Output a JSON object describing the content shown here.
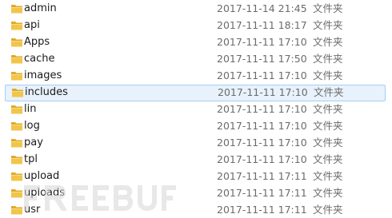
{
  "files": [
    {
      "name": "admin",
      "date": "2017-11-14 21:45",
      "type": "文件夹",
      "icon": "folder-icon"
    },
    {
      "name": "api",
      "date": "2017-11-11 18:17",
      "type": "文件夹",
      "icon": "folder-icon"
    },
    {
      "name": "Apps",
      "date": "2017-11-11 17:10",
      "type": "文件夹",
      "icon": "folder-icon"
    },
    {
      "name": "cache",
      "date": "2017-11-11 17:50",
      "type": "文件夹",
      "icon": "folder-icon"
    },
    {
      "name": "images",
      "date": "2017-11-11 17:10",
      "type": "文件夹",
      "icon": "folder-icon"
    },
    {
      "name": "includes",
      "date": "2017-11-11 17:10",
      "type": "文件夹",
      "icon": "folder-icon",
      "selected": true
    },
    {
      "name": "lin",
      "date": "2017-11-11 17:10",
      "type": "文件夹",
      "icon": "folder-icon"
    },
    {
      "name": "log",
      "date": "2017-11-11 17:10",
      "type": "文件夹",
      "icon": "folder-icon"
    },
    {
      "name": "pay",
      "date": "2017-11-11 17:10",
      "type": "文件夹",
      "icon": "folder-icon"
    },
    {
      "name": "tpl",
      "date": "2017-11-11 17:10",
      "type": "文件夹",
      "icon": "folder-icon"
    },
    {
      "name": "upload",
      "date": "2017-11-11 17:11",
      "type": "文件夹",
      "icon": "folder-icon"
    },
    {
      "name": "uploads",
      "date": "2017-11-11 17:11",
      "type": "文件夹",
      "icon": "folder-icon"
    },
    {
      "name": "usr",
      "date": "2017-11-11 17:11",
      "type": "文件夹",
      "icon": "folder-icon"
    }
  ],
  "watermark": {
    "text": "FREEBUF"
  },
  "colors": {
    "folder_body": "#f0c64a",
    "folder_back": "#e2a92a",
    "selection_fill": "#e8f2fc",
    "selection_border": "#a8cdf2"
  }
}
